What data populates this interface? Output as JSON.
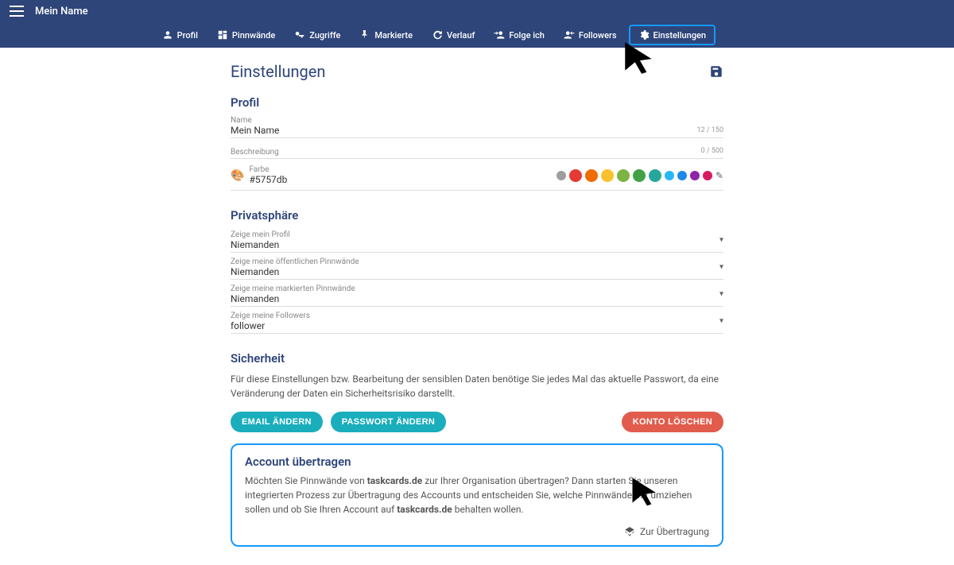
{
  "topbar": {
    "username": "Mein Name"
  },
  "nav": [
    {
      "label": "Profil"
    },
    {
      "label": "Pinnwände"
    },
    {
      "label": "Zugriffe"
    },
    {
      "label": "Markierte"
    },
    {
      "label": "Verlauf"
    },
    {
      "label": "Folge ich"
    },
    {
      "label": "Followers"
    },
    {
      "label": "Einstellungen"
    }
  ],
  "page_title": "Einstellungen",
  "profile": {
    "heading": "Profil",
    "name_label": "Name",
    "name_value": "Mein Name",
    "name_counter": "12 / 150",
    "desc_label": "Beschreibung",
    "desc_counter": "0 / 500",
    "color_label": "Farbe",
    "color_value": "#5757db"
  },
  "privacy": {
    "heading": "Privatsphäre",
    "rows": [
      {
        "label": "Zeige mein Profil",
        "value": "Niemanden"
      },
      {
        "label": "Zeige meine öffentlichen Pinnwände",
        "value": "Niemanden"
      },
      {
        "label": "Zeige meine markierten Pinnwände",
        "value": "Niemanden"
      },
      {
        "label": "Zeige meine Followers",
        "value": "follower"
      }
    ]
  },
  "security": {
    "heading": "Sicherheit",
    "text": "Für diese Einstellungen bzw. Bearbeitung der sensiblen Daten benötige Sie jedes Mal das aktuelle Passwort, da eine Veränderung der Daten ein Sicherheitsrisiko darstellt.",
    "btn_email": "EMAIL ÄNDERN",
    "btn_pw": "PASSWORT ÄNDERN",
    "btn_delete": "KONTO LÖSCHEN"
  },
  "transfer": {
    "heading": "Account übertragen",
    "text_pre": "Möchten Sie Pinnwände von ",
    "bold1": "taskcards.de",
    "text_mid": " zur Ihrer Organisation übertragen? Dann starten Sie unseren integrierten Prozess zur Übertragung des Accounts und entscheiden Sie, welche Pinnwände mit umziehen sollen und ob Sie Ihren Account auf ",
    "bold2": "taskcards.de",
    "text_post": " behalten wollen.",
    "action": "Zur Übertragung"
  },
  "swatches": [
    "#9e9e9e",
    "#e53935",
    "#ef6c00",
    "#fbc02d",
    "#7cb342",
    "#43a047",
    "#26a69a",
    "#29b6f6",
    "#1e88e5",
    "#8e24aa",
    "#d81b60"
  ]
}
